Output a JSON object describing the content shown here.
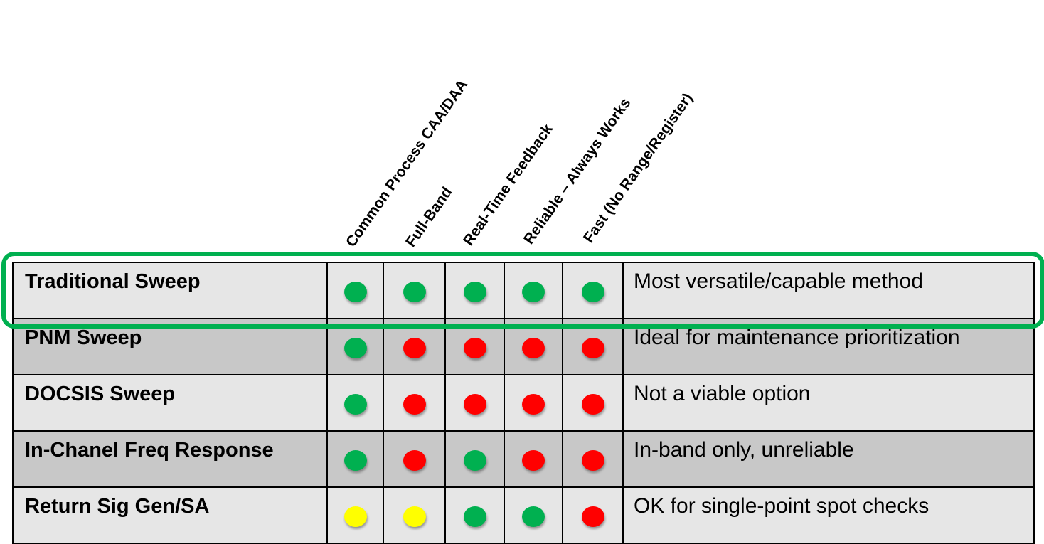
{
  "colors": {
    "good": "#00b050",
    "bad": "#ff0000",
    "partial": "#ffff00",
    "highlight": "#00b050",
    "row_light": "#e6e6e6",
    "row_dark": "#c8c8c8"
  },
  "columns": [
    "Common Process CAA/DAA",
    "Full-Band",
    "Real-Time Feedback",
    "Reliable – Always Works",
    "Fast (No Range/Register)"
  ],
  "rows": [
    {
      "method": "Traditional Sweep",
      "ratings": [
        "good",
        "good",
        "good",
        "good",
        "good"
      ],
      "note": "Most versatile/capable method",
      "highlighted": true
    },
    {
      "method": "PNM Sweep",
      "ratings": [
        "good",
        "bad",
        "bad",
        "bad",
        "bad"
      ],
      "note": "Ideal for maintenance prioritization",
      "highlighted": false
    },
    {
      "method": "DOCSIS Sweep",
      "ratings": [
        "good",
        "bad",
        "bad",
        "bad",
        "bad"
      ],
      "note": "Not a viable option",
      "highlighted": false
    },
    {
      "method": "In-Chanel  Freq Response",
      "ratings": [
        "good",
        "bad",
        "good",
        "bad",
        "bad"
      ],
      "note": "In-band only, unreliable",
      "highlighted": false
    },
    {
      "method": "Return Sig Gen/SA",
      "ratings": [
        "partial",
        "partial",
        "good",
        "good",
        "bad"
      ],
      "note": "OK for single-point spot checks",
      "highlighted": false
    }
  ]
}
